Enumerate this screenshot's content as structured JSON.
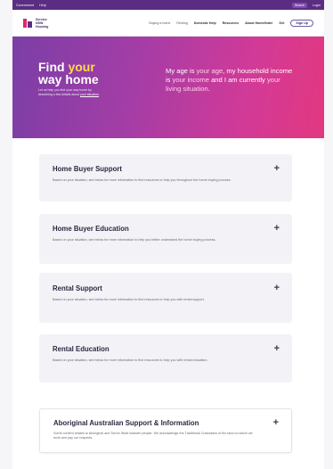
{
  "top_strip": {
    "left_links": [
      "Government",
      "Help"
    ],
    "right_links": [
      "Search",
      "Login"
    ]
  },
  "nav": {
    "logo_lines": [
      "Service",
      "NSW",
      "Housing"
    ],
    "links": [
      "Buying a home",
      "Renting",
      "Domestic Help",
      "Resources",
      "About Homefinder",
      "Get"
    ],
    "sign_up": "Sign Up"
  },
  "hero": {
    "title_line1_a": "Find ",
    "title_line1_b": "your",
    "title_line2": "way home",
    "description_a": "Let us help you find your way home by describing a few details about ",
    "description_link": "your situation",
    "statement_a": "My age is ",
    "statement_b": "your age",
    "statement_c": ", my household income is ",
    "statement_d": "your income",
    "statement_e": " and I am currently ",
    "statement_f": "your living situation",
    "statement_g": "."
  },
  "cards": [
    {
      "title": "Home Buyer Support",
      "description": "Based on your situation, see below for more information to find resources to help you throughout the home buying process.",
      "icon": "plus-icon"
    },
    {
      "title": "Home Buyer Education",
      "description": "Based on your situation, see below for more information to help you better understand the home buying process.",
      "icon": "plus-icon"
    },
    {
      "title": "Rental Support",
      "description": "Based on your situation, see below for more information to find resources to help you with rental support.",
      "icon": "plus-icon"
    },
    {
      "title": "Rental Education",
      "description": "Based on your situation, see below for more information to find resources to help you with rental education.",
      "icon": "plus-icon"
    },
    {
      "title": "Aboriginal Australian Support & Information",
      "description": "Some content relates to Aboriginal and Torres Strait Islander people. We acknowledge the Traditional Custodians of the land on which we work and pay our respects.",
      "icon": "plus-icon"
    }
  ],
  "plus_symbol": "+",
  "colors": {
    "brand_purple": "#5a2d82",
    "brand_pink": "#e2246d",
    "hero_gradient_start": "#7a3fa6",
    "hero_gradient_end": "#e2387f",
    "highlight_yellow": "#ffd84d"
  }
}
